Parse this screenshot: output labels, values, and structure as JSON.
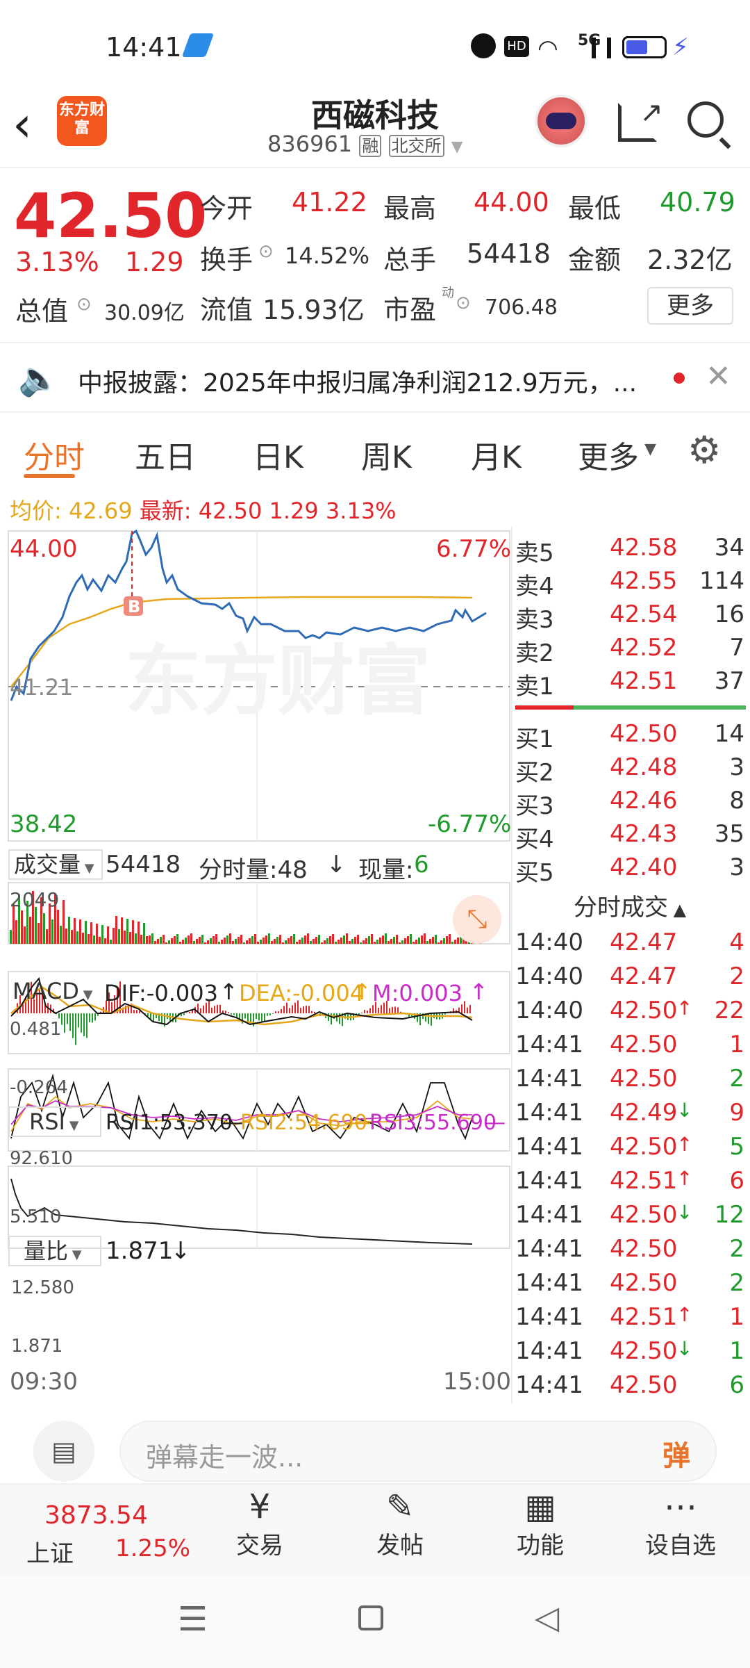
{
  "status_bar": {
    "time": "14:41",
    "network": "5G"
  },
  "header": {
    "title": "西磁科技",
    "code": "836961",
    "tags": [
      "融",
      "北交所"
    ],
    "logo": "东方财富"
  },
  "quote": {
    "price": "42.50",
    "pct": "3.13%",
    "chg": "1.29",
    "open_label": "今开",
    "open": "41.22",
    "high_label": "最高",
    "high": "44.00",
    "low_label": "最低",
    "low": "40.79",
    "turnover_label": "换手",
    "turnover": "14.52%",
    "vol_label": "总手",
    "vol": "54418",
    "amount_label": "金额",
    "amount": "2.32亿",
    "mktcap_label": "总值",
    "mktcap": "30.09亿",
    "float_label": "流值",
    "float": "15.93亿",
    "pe_label": "市盈",
    "pe_sup": "动",
    "pe": "706.48",
    "more": "更多"
  },
  "notice": {
    "text": "中报披露：2025年中报归属净利润212.9万元，..."
  },
  "tabs": [
    "分时",
    "五日",
    "日K",
    "周K",
    "月K",
    "更多"
  ],
  "chart_header": {
    "avg_label": "均价:",
    "avg": "42.69",
    "latest_label": "最新:",
    "latest": "42.50",
    "chg": "1.29",
    "pct": "3.13%"
  },
  "chart_labels": {
    "top": "44.00",
    "top_pct": "6.77%",
    "mid": "41.21",
    "bottom": "38.42",
    "bottom_pct": "-6.77%",
    "marker": "B",
    "watermark": "东方财富",
    "vol_title": "成交量",
    "vol_total": "54418",
    "vol_minute": "分时量:48",
    "vol_now_label": "现量:",
    "vol_now": "6",
    "vol_max": "2049",
    "macd_title": "MACD",
    "dif": "DIF:-0.003",
    "dea": "DEA:-0.004",
    "m": "M:0.003",
    "macd_top": "0.481",
    "macd_bottom": "-0.264",
    "rsi_title": "RSI",
    "rsi1": "RSI1:53.370",
    "rsi2": "RSI2:54.690",
    "rsi3": "RSI3:55.690",
    "rsi_top": "92.610",
    "rsi_bottom": "5.510",
    "lb_title": "量比",
    "lb_val": "1.871",
    "lb_top": "12.580",
    "lb_bottom": "1.871",
    "t_start": "09:30",
    "t_end": "15:00"
  },
  "orderbook": {
    "sell": [
      {
        "l": "卖5",
        "p": "42.58",
        "v": "34"
      },
      {
        "l": "卖4",
        "p": "42.55",
        "v": "114"
      },
      {
        "l": "卖3",
        "p": "42.54",
        "v": "16"
      },
      {
        "l": "卖2",
        "p": "42.52",
        "v": "7"
      },
      {
        "l": "卖1",
        "p": "42.51",
        "v": "37"
      }
    ],
    "buy": [
      {
        "l": "买1",
        "p": "42.50",
        "v": "14"
      },
      {
        "l": "买2",
        "p": "42.48",
        "v": "3"
      },
      {
        "l": "买3",
        "p": "42.46",
        "v": "8"
      },
      {
        "l": "买4",
        "p": "42.43",
        "v": "35"
      },
      {
        "l": "买5",
        "p": "42.40",
        "v": "3"
      }
    ]
  },
  "trades_title": "分时成交",
  "trades": [
    {
      "t": "14:40",
      "p": "42.47",
      "a": "",
      "v": "4",
      "c": "red"
    },
    {
      "t": "14:40",
      "p": "42.47",
      "a": "",
      "v": "2",
      "c": "red"
    },
    {
      "t": "14:40",
      "p": "42.50",
      "a": "↑",
      "v": "22",
      "c": "red"
    },
    {
      "t": "14:41",
      "p": "42.50",
      "a": "",
      "v": "1",
      "c": "red"
    },
    {
      "t": "14:41",
      "p": "42.50",
      "a": "",
      "v": "2",
      "c": "green"
    },
    {
      "t": "14:41",
      "p": "42.49",
      "a": "↓",
      "v": "9",
      "c": "red"
    },
    {
      "t": "14:41",
      "p": "42.50",
      "a": "↑",
      "v": "5",
      "c": "green"
    },
    {
      "t": "14:41",
      "p": "42.51",
      "a": "↑",
      "v": "6",
      "c": "red"
    },
    {
      "t": "14:41",
      "p": "42.50",
      "a": "↓",
      "v": "12",
      "c": "green"
    },
    {
      "t": "14:41",
      "p": "42.50",
      "a": "",
      "v": "2",
      "c": "green"
    },
    {
      "t": "14:41",
      "p": "42.50",
      "a": "",
      "v": "2",
      "c": "green"
    },
    {
      "t": "14:41",
      "p": "42.51",
      "a": "↑",
      "v": "1",
      "c": "red"
    },
    {
      "t": "14:41",
      "p": "42.50",
      "a": "↓",
      "v": "1",
      "c": "green"
    },
    {
      "t": "14:41",
      "p": "42.50",
      "a": "",
      "v": "6",
      "c": "green"
    }
  ],
  "comment": {
    "placeholder": "弹幕走一波...",
    "danmu": "弹"
  },
  "bottom_nav": {
    "index_value": "3873.54",
    "index_name": "上证",
    "index_pct": "1.25%",
    "items": [
      "交易",
      "发帖",
      "功能",
      "设自选"
    ]
  }
}
